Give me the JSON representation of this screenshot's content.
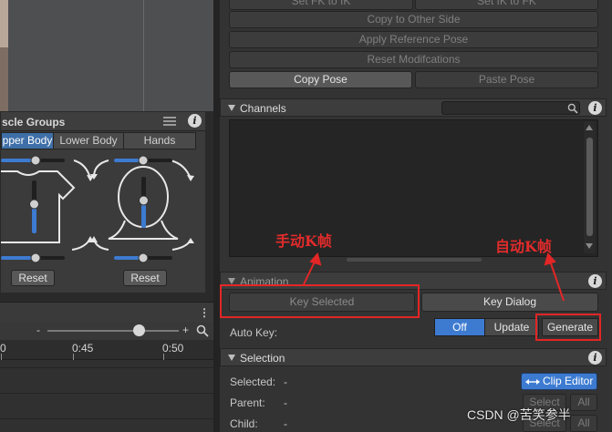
{
  "muscle_groups": {
    "title": "scle Groups",
    "tabs": [
      {
        "label": "pper Body",
        "selected": true
      },
      {
        "label": "Lower Body",
        "selected": false
      },
      {
        "label": "Hands",
        "selected": false
      }
    ],
    "reset_left": "Reset",
    "reset_right": "Reset"
  },
  "timeline": {
    "kebab": "⋮",
    "zoom_minus": "-",
    "zoom_plus": "+",
    "zoom_level": 0.72,
    "ticks": [
      "0",
      "0:45",
      "0:50"
    ]
  },
  "pose_buttons": {
    "set_fk_to_ik": "Set FK to IK",
    "set_ik_to_fk": "Set IK to FK",
    "copy_to_other_side": "Copy to Other Side",
    "apply_reference_pose": "Apply Reference Pose",
    "reset_modifications": "Reset Modifcations",
    "copy_pose": "Copy Pose",
    "paste_pose": "Paste Pose"
  },
  "channels": {
    "title": "Channels",
    "search_value": ""
  },
  "animation": {
    "title": "Animation",
    "key_selected": "Key Selected",
    "key_dialog": "Key Dialog",
    "auto_key_label": "Auto Key:",
    "auto_key_options": [
      {
        "label": "Off",
        "selected": true
      },
      {
        "label": "Update",
        "selected": false
      },
      {
        "label": "Generate",
        "selected": false
      }
    ]
  },
  "selection": {
    "title": "Selection",
    "selected_label": "Selected:",
    "selected_value": "-",
    "parent_label": "Parent:",
    "parent_value": "-",
    "child_label": "Child:",
    "child_value": "-",
    "clip_editor": "Clip Editor",
    "select": "Select",
    "all": "All"
  },
  "annotations": {
    "manual_keyframe": "手动K帧",
    "auto_keyframe": "自动K帧"
  },
  "watermark": "CSDN @苦笑参半",
  "colors": {
    "accent": "#3d7bd1",
    "annotation": "#e32626",
    "panel_bg": "#333333"
  },
  "icons": [
    "menu-icon",
    "info-icon",
    "search-icon",
    "arrows-icon"
  ]
}
